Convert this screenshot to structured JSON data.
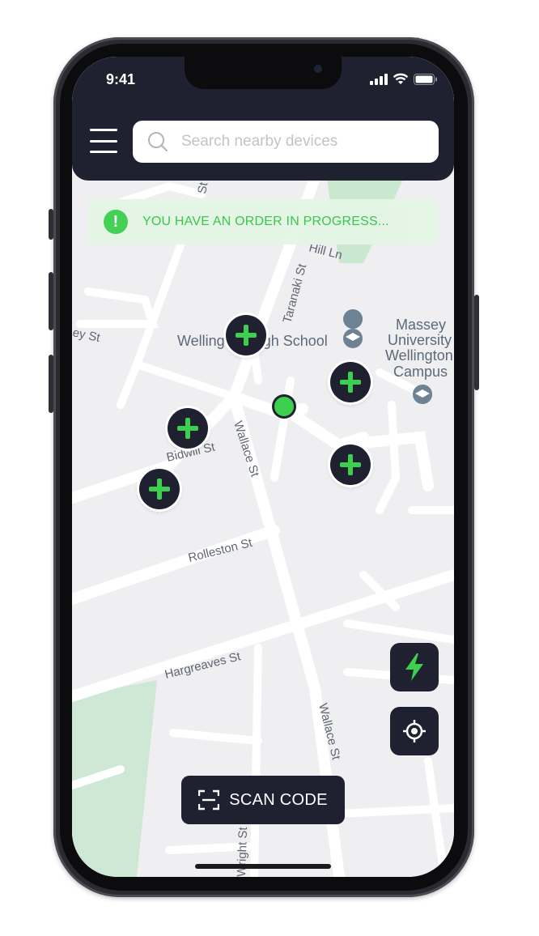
{
  "status_bar": {
    "time": "9:41"
  },
  "search": {
    "placeholder": "Search nearby devices"
  },
  "banner": {
    "icon": "!",
    "text": "YOU HAVE AN ORDER IN PROGRESS..."
  },
  "map": {
    "labels": {
      "taranaki": "Taranaki St",
      "hill": "Hill Ln",
      "school": "Wellington High School",
      "massey_1": "Massey",
      "massey_2": "University",
      "massey_3": "Wellington",
      "massey_4": "Campus",
      "ey": "ey St",
      "bidwill": "Bidwill St",
      "wallace_1": "Wallace St",
      "rolleston": "Rolleston St",
      "hargreaves": "Hargreaves St",
      "wallace_2": "Wallace St",
      "st_top": "St",
      "wright": "Wright St"
    }
  },
  "buttons": {
    "scan_label": "SCAN CODE"
  },
  "icons": {
    "menu": "hamburger-icon",
    "search": "search-icon",
    "alert": "exclamation-icon",
    "charger_pin": "plus-icon",
    "bolt": "lightning-icon",
    "locate": "crosshair-icon",
    "scan": "scan-frame-icon"
  },
  "colors": {
    "dark": "#1f2130",
    "accent": "#3dcf4f",
    "banner_bg": "#e4f6e6",
    "map_bg": "#efeff1"
  }
}
